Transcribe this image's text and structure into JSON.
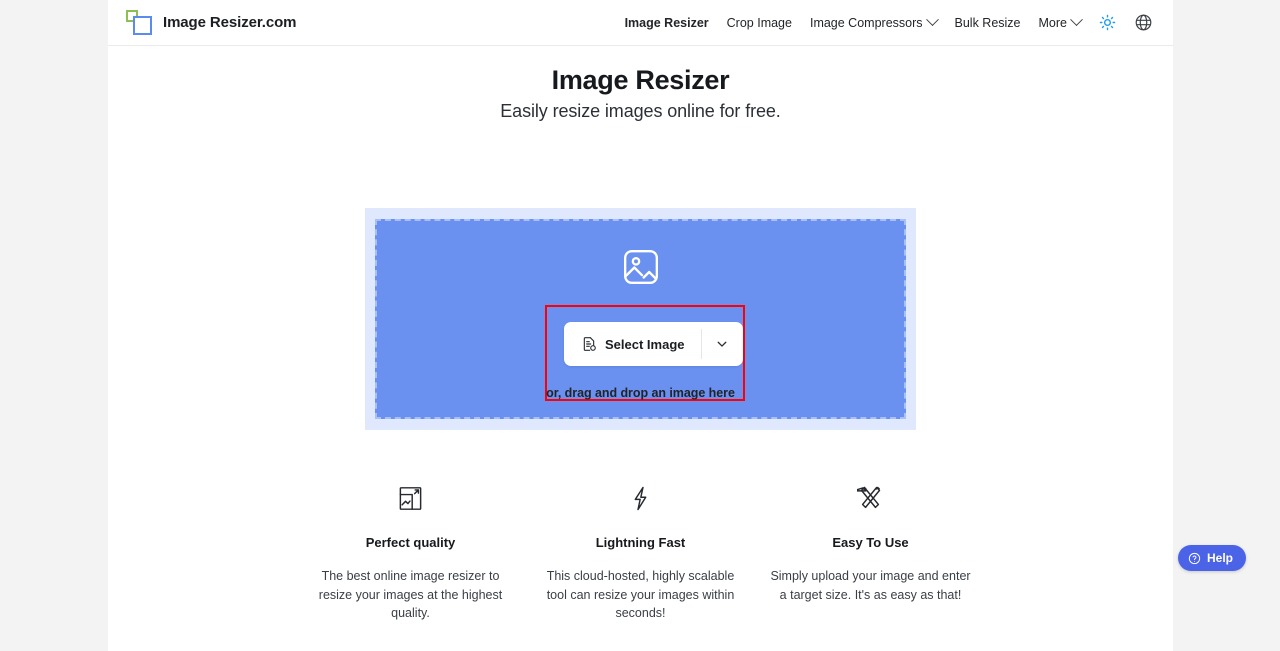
{
  "brand": {
    "name": "Image Resizer.com",
    "logo_icon": "overlapping-squares-logo",
    "green_hex": "#8cc152",
    "blue_hex": "#5a8cf0"
  },
  "nav": {
    "items": [
      {
        "label": "Image Resizer",
        "active": true,
        "has_chevron": false
      },
      {
        "label": "Crop Image",
        "active": false,
        "has_chevron": false
      },
      {
        "label": "Image Compressors",
        "active": false,
        "has_chevron": true
      },
      {
        "label": "Bulk Resize",
        "active": false,
        "has_chevron": false
      },
      {
        "label": "More",
        "active": false,
        "has_chevron": true
      }
    ],
    "theme_toggle_icon": "sun-icon",
    "theme_toggle_hex": "#1e9df1",
    "language_icon": "globe-icon"
  },
  "hero": {
    "title": "Image Resizer",
    "subtitle": "Easily resize images online for free."
  },
  "dropzone": {
    "placeholder_icon": "image-placeholder-icon",
    "select_label": "Select Image",
    "select_icon": "file-select-icon",
    "caret_icon": "chevron-down-icon",
    "hint": "or, drag and drop an image here",
    "outer_hex": "#dfe8fc",
    "inner_hex": "#6a90f0",
    "dashed_border_hex": "#a8c0f7",
    "highlight_hex": "#fb0007"
  },
  "features": [
    {
      "icon": "resize-image-icon",
      "title": "Perfect quality",
      "desc": "The best online image resizer to resize your images at the highest quality."
    },
    {
      "icon": "lightning-bolt-icon",
      "title": "Lightning Fast",
      "desc": "This cloud-hosted, highly scalable tool can resize your images within seconds!"
    },
    {
      "icon": "pencil-ruler-icon",
      "title": "Easy To Use",
      "desc": "Simply upload your image and enter a target size. It's as easy as that!"
    }
  ],
  "help": {
    "label": "Help",
    "icon": "question-circle-icon",
    "background_hex": "#4a63e7"
  }
}
